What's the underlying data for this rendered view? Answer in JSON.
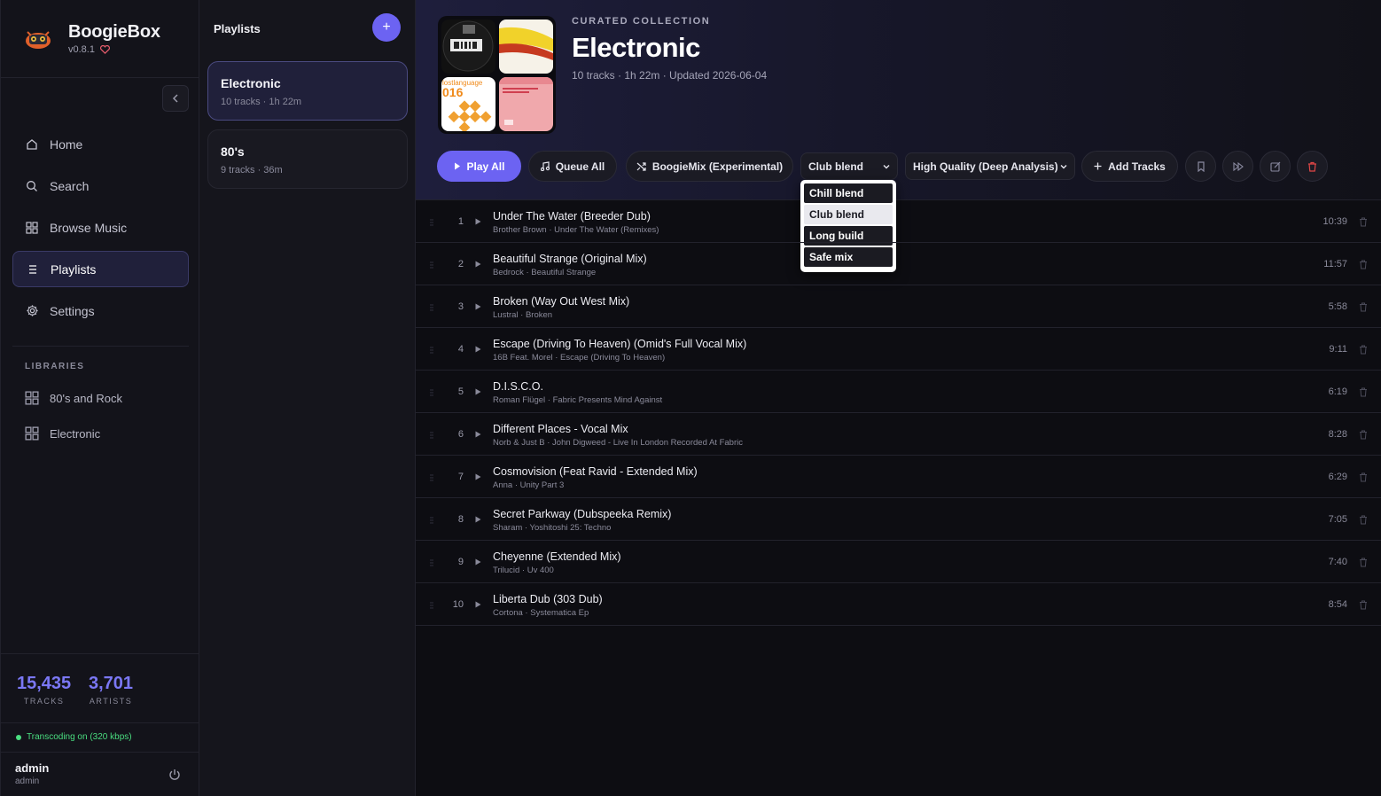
{
  "app": {
    "name": "BoogieBox",
    "version": "v0.8.1"
  },
  "nav": [
    {
      "label": "Home",
      "icon": "home-icon"
    },
    {
      "label": "Search",
      "icon": "search-icon"
    },
    {
      "label": "Browse Music",
      "icon": "grid-icon"
    },
    {
      "label": "Playlists",
      "icon": "list-icon",
      "active": true
    },
    {
      "label": "Settings",
      "icon": "gear-icon"
    }
  ],
  "libraries": {
    "heading": "LIBRARIES",
    "items": [
      {
        "label": "80's and Rock"
      },
      {
        "label": "Electronic"
      }
    ]
  },
  "stats": {
    "tracks": "15,435",
    "tracks_label": "TRACKS",
    "artists": "3,701",
    "artists_label": "ARTISTS"
  },
  "transcoding": "Transcoding on (320 kbps)",
  "user": {
    "name": "admin",
    "role": "admin"
  },
  "playlists_panel": {
    "title": "Playlists",
    "add_label": "+",
    "items": [
      {
        "name": "Electronic",
        "meta": "10 tracks · 1h 22m",
        "active": true
      },
      {
        "name": "80's",
        "meta": "9 tracks · 36m"
      }
    ]
  },
  "header": {
    "eyebrow": "CURATED COLLECTION",
    "title": "Electronic",
    "subtitle": "10 tracks · 1h 22m · Updated 2026-06-04",
    "cover_texts": {
      "c3_top": "lostlanguage",
      "c3_num": "016"
    }
  },
  "toolbar": {
    "play_all": "Play All",
    "queue_all": "Queue All",
    "boogiemix": "BoogieMix (Experimental)",
    "blend_selected": "Club blend",
    "quality_selected": "High Quality (Deep Analysis)",
    "add_tracks": "Add Tracks"
  },
  "blend_options": [
    "Chill blend",
    "Club blend",
    "Long build",
    "Safe mix"
  ],
  "tracks": [
    {
      "num": "1",
      "title": "Under The Water (Breeder Dub)",
      "sub": "Brother Brown · Under The Water (Remixes)",
      "dur": "10:39"
    },
    {
      "num": "2",
      "title": "Beautiful Strange (Original Mix)",
      "sub": "Bedrock · Beautiful Strange",
      "dur": "11:57"
    },
    {
      "num": "3",
      "title": "Broken (Way Out West Mix)",
      "sub": "Lustral · Broken",
      "dur": "5:58"
    },
    {
      "num": "4",
      "title": "Escape (Driving To Heaven) (Omid's Full Vocal Mix)",
      "sub": "16B Feat. Morel · Escape (Driving To Heaven)",
      "dur": "9:11"
    },
    {
      "num": "5",
      "title": "D.I.S.C.O.",
      "sub": "Roman Flügel · Fabric Presents Mind Against",
      "dur": "6:19"
    },
    {
      "num": "6",
      "title": "Different Places - Vocal Mix",
      "sub": "Norb & Just B · John Digweed - Live In London Recorded At Fabric",
      "dur": "8:28"
    },
    {
      "num": "7",
      "title": "Cosmovision (Feat Ravid - Extended Mix)",
      "sub": "Anna · Unity Part 3",
      "dur": "6:29"
    },
    {
      "num": "8",
      "title": "Secret Parkway (Dubspeeka Remix)",
      "sub": "Sharam · Yoshitoshi 25: Techno",
      "dur": "7:05"
    },
    {
      "num": "9",
      "title": "Cheyenne (Extended Mix)",
      "sub": "Trilucid · Uv 400",
      "dur": "7:40"
    },
    {
      "num": "10",
      "title": "Liberta Dub (303 Dub)",
      "sub": "Cortona · Systematica Ep",
      "dur": "8:54"
    }
  ],
  "colors": {
    "accent": "#6c63f2",
    "stat": "#7b78f5",
    "danger": "#e04646",
    "ok": "#4ade80"
  }
}
